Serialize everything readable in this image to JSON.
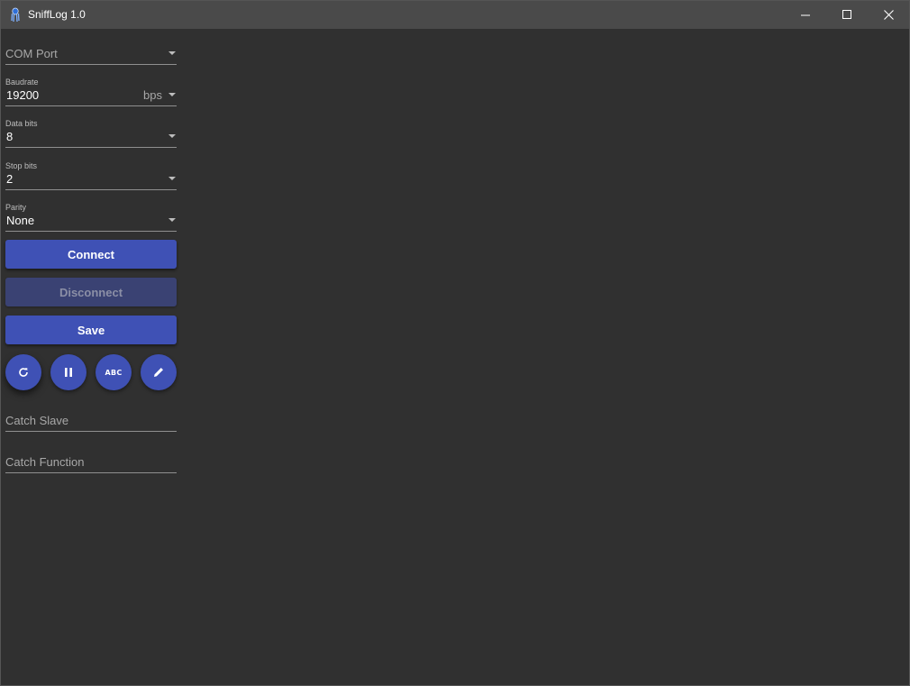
{
  "window": {
    "title": "SniffLog 1.0",
    "icons": {
      "app": "bug-icon",
      "minimize": "minimize-icon",
      "maximize": "maximize-icon",
      "close": "close-icon"
    }
  },
  "colors": {
    "accent": "#3f51b5",
    "background": "#303030",
    "titlebar": "#4a4a4a",
    "disabled_button": "#3a4273"
  },
  "form": {
    "com_port": {
      "placeholder": "COM Port"
    },
    "baudrate": {
      "label": "Baudrate",
      "value": "19200",
      "unit": "bps"
    },
    "data_bits": {
      "label": "Data bits",
      "value": "8"
    },
    "stop_bits": {
      "label": "Stop bits",
      "value": "2"
    },
    "parity": {
      "label": "Parity",
      "value": "None"
    }
  },
  "buttons": {
    "connect": "Connect",
    "disconnect": "Disconnect",
    "save": "Save"
  },
  "fabs": {
    "refresh": {
      "icon": "refresh-icon"
    },
    "pause": {
      "icon": "pause-icon"
    },
    "abc": {
      "icon": "abc-icon",
      "text": "ABC"
    },
    "edit": {
      "icon": "pencil-icon"
    }
  },
  "filters": {
    "catch_slave": {
      "placeholder": "Catch Slave"
    },
    "catch_function": {
      "placeholder": "Catch Function"
    }
  }
}
